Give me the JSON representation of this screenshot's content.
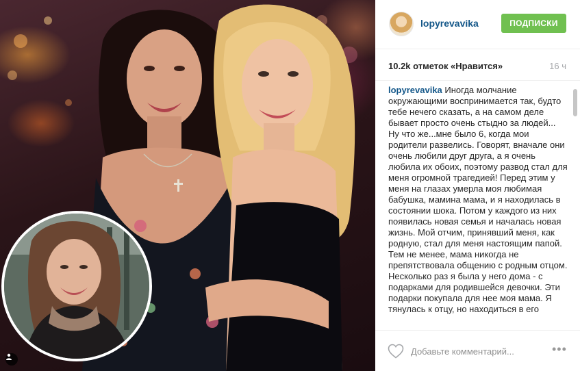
{
  "post": {
    "username": "lopyrevavika",
    "follow_label": "ПОДПИСКИ",
    "likes_text": "10.2k отметок «Нравится»",
    "time_ago": "16 ч",
    "caption_user": "lopyrevavika",
    "caption_text": "Иногда молчание окружающими воспринимается так, будто тебе нечего сказать, а на самом деле бывает просто очень стыдно за людей... Ну что же...мне было 6, когда мои родители развелись. Говорят, вначале они очень любили друг друга, а я очень любила их обоих, поэтому развод стал для меня огромной трагедией! Перед этим у меня на глазах умерла моя любимая бабушка, мамина мама, и я находилась в состоянии шока. Потом у каждого из них появилась новая семья и началась новая жизнь. Мой отчим, принявший меня, как родную, стал для меня настоящим папой. Тем не менее, мама никогда не препятствовала общению с родным отцом. Несколько раз я была у него дома - с подарками для родившейся девочки. Эти подарки покупала для нее моя мама. Я тянулась к отцу, но находиться в его",
    "comment_placeholder": "Добавьте комментарий..."
  },
  "icons": {
    "heart": "heart-icon",
    "more": "more-options-icon",
    "user_tag": "user-tag-icon"
  },
  "colors": {
    "username": "#125688",
    "follow_button": "#70c050",
    "muted": "#a5a7aa"
  }
}
